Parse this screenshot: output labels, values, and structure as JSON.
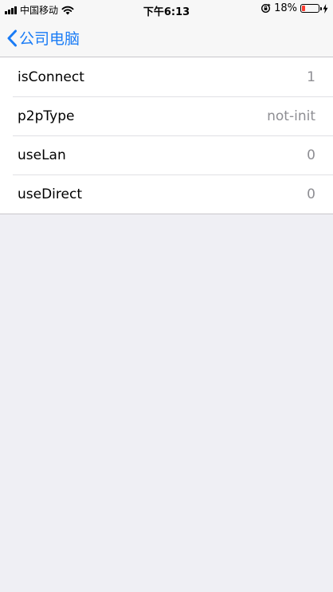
{
  "status_bar": {
    "carrier": "中国移动",
    "time": "下午6:13",
    "battery_percent": "18%",
    "battery_level": 0.18
  },
  "nav": {
    "back_label": "公司电脑"
  },
  "settings_rows": [
    {
      "label": "isConnect",
      "value": "1"
    },
    {
      "label": "p2pType",
      "value": "not-init"
    },
    {
      "label": "useLan",
      "value": "0"
    },
    {
      "label": "useDirect",
      "value": "0"
    }
  ],
  "colors": {
    "accent": "#1a7cf6",
    "background": "#efeff4",
    "battery_low": "#ff3b30"
  }
}
